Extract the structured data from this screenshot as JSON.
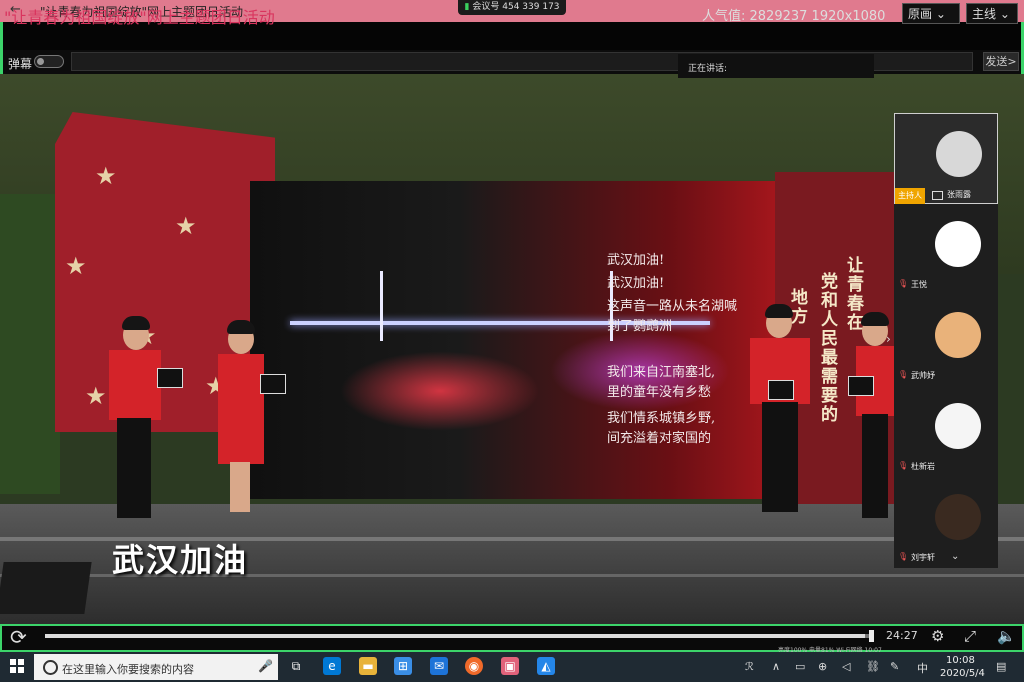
{
  "window": {
    "title": "\"让青春为祖国绽放\"网上主题团日活动",
    "meeting_id": "会议号 454 339 173"
  },
  "header": {
    "live_title": "\"让青春为祖国绽放\"网上主题团日活动",
    "popularity": "人气值:  2829237  1920x1080",
    "quality_select": "原画",
    "line_select": "主线"
  },
  "danmaku": {
    "label": "弹幕",
    "send_label": "发送>",
    "speaking_label": "正在讲话:"
  },
  "video": {
    "poem_lines": [
      "武汉加油!",
      "武汉加油!",
      "这声音一路从未名湖喊",
      "到了鹦鹉洲",
      "我们来自江南塞北,",
      "里的童年没有乡愁",
      "我们情系城镇乡野,",
      "间充溢着对家国的"
    ],
    "slogan_left": "让青春在",
    "slogan_mid": "党和人民最需要的",
    "slogan_right": "地方",
    "subtitle": "武汉加油"
  },
  "participants": [
    {
      "name": "张雨露",
      "host_badge": "主持人",
      "avatar": "doctor-avatar"
    },
    {
      "name": "王悦",
      "avatar": "cartoon-avatar"
    },
    {
      "name": "武帅妤",
      "avatar": "cat-avatar"
    },
    {
      "name": "杜新岩",
      "avatar": "stickman-avatar"
    },
    {
      "name": "刘宇轩",
      "avatar": "dark-photo-avatar"
    }
  ],
  "player": {
    "progress": 0.99,
    "time": "24:27",
    "stats": "亮度100%  电量81%  Wi-Fi网络  10:07"
  },
  "taskbar": {
    "search_placeholder": "在这里输入你要搜索的内容",
    "time": "10:08",
    "date": "2020/5/4",
    "ime": "中"
  },
  "colors": {
    "accent_green": "#3cd46a",
    "title_pink": "#e07a8e",
    "live_title_red": "#d9345e",
    "host_badge": "#f0a500"
  }
}
